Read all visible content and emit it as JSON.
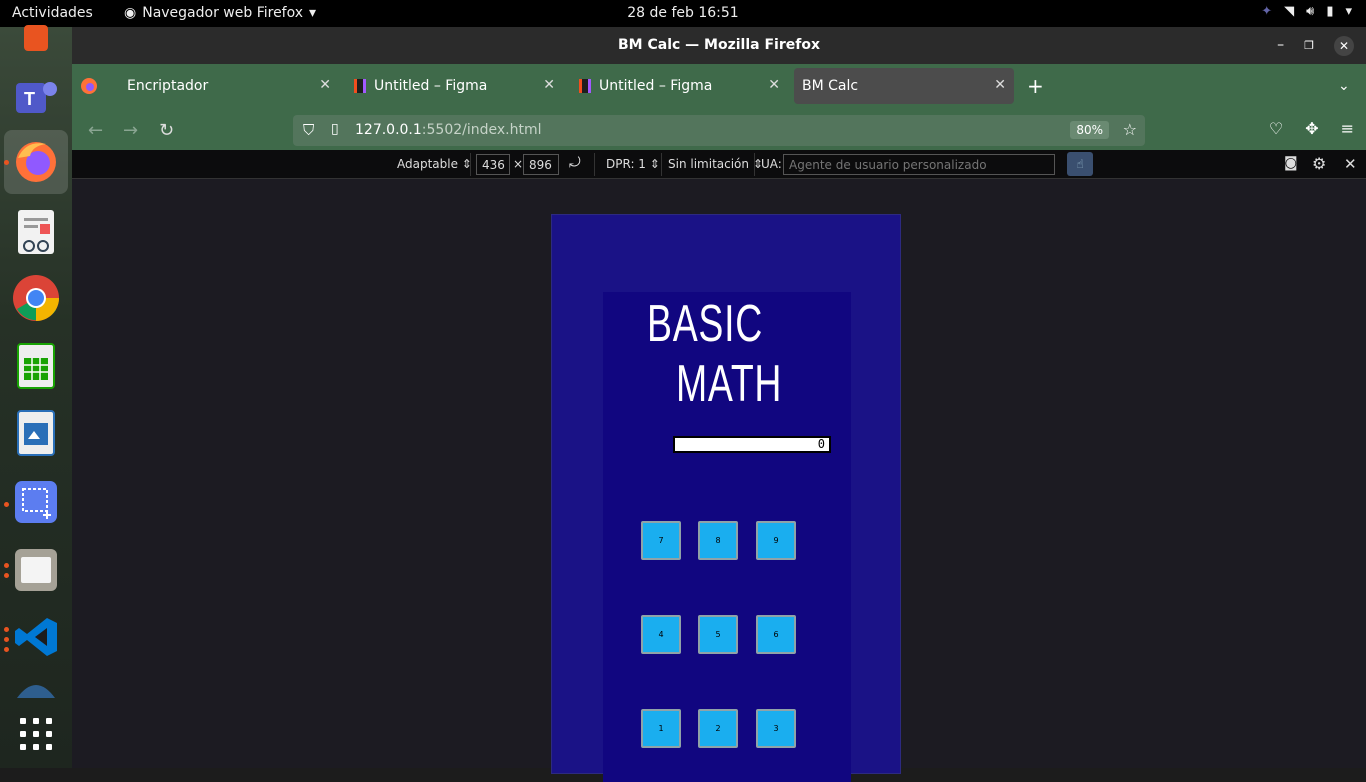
{
  "topbar": {
    "activities": "Actividades",
    "app_name": "Navegador web Firefox",
    "clock": "28 de feb  16:51"
  },
  "window": {
    "title": "BM Calc — Mozilla Firefox"
  },
  "tabs": [
    {
      "label": "Encriptador",
      "icon": "firefox-icon"
    },
    {
      "label": "Untitled – Figma",
      "icon": "figma-icon"
    },
    {
      "label": "Untitled – Figma",
      "icon": "figma-icon"
    },
    {
      "label": "BM Calc",
      "icon": "none",
      "selected": true
    }
  ],
  "navbar": {
    "url_host": "127.0.0.1",
    "url_rest": ":5502/index.html",
    "zoom": "80%"
  },
  "rdm": {
    "device": "Adaptable",
    "width": "436",
    "times": "×",
    "height": "896",
    "dpr": "DPR: 1",
    "throttle": "Sin limitación",
    "ua_label": "UA:",
    "ua_placeholder": "Agente de usuario personalizado"
  },
  "calc": {
    "title_line1": "BASIC",
    "title_line2": "MATH",
    "display_value": "0",
    "keys": [
      "7",
      "8",
      "9",
      "4",
      "5",
      "6",
      "1",
      "2",
      "3"
    ]
  },
  "colors": {
    "device_bg": "#1a1286",
    "calc_bg": "#110680",
    "key_bg": "#1aaeef",
    "tab_bar": "#3f6a4a"
  }
}
